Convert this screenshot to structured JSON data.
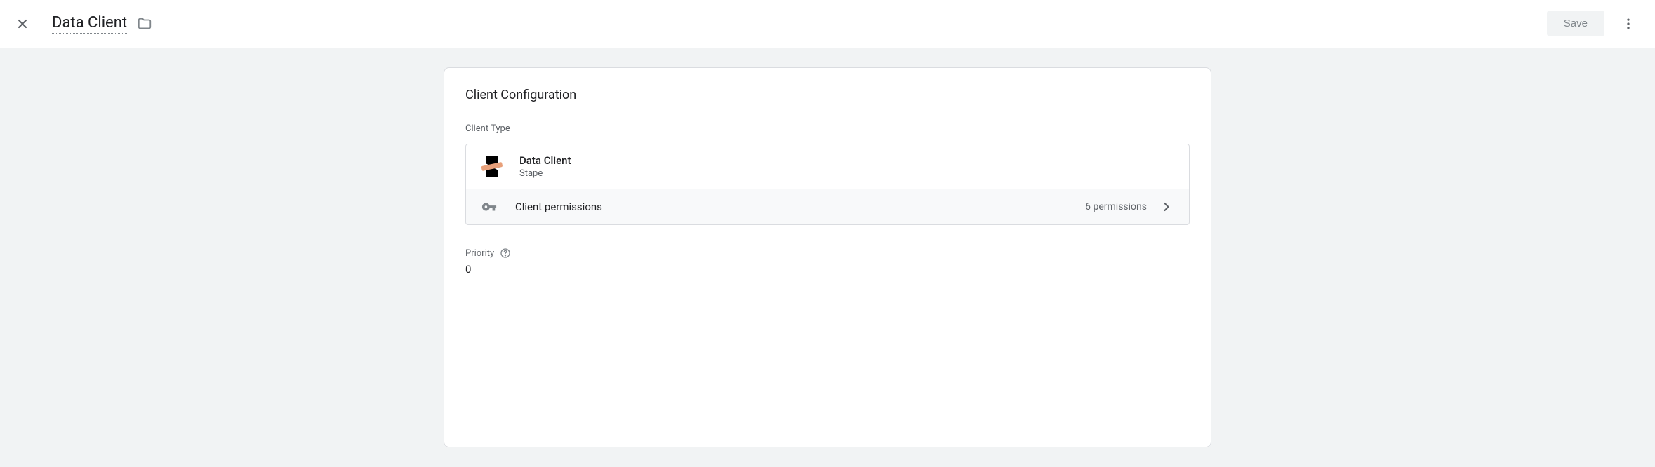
{
  "header": {
    "title": "Data Client",
    "save_label": "Save"
  },
  "card": {
    "title": "Client Configuration",
    "client_type_label": "Client Type",
    "client": {
      "name": "Data Client",
      "vendor": "Stape"
    },
    "permissions": {
      "label": "Client permissions",
      "count_text": "6 permissions"
    },
    "priority": {
      "label": "Priority",
      "value": "0"
    }
  }
}
